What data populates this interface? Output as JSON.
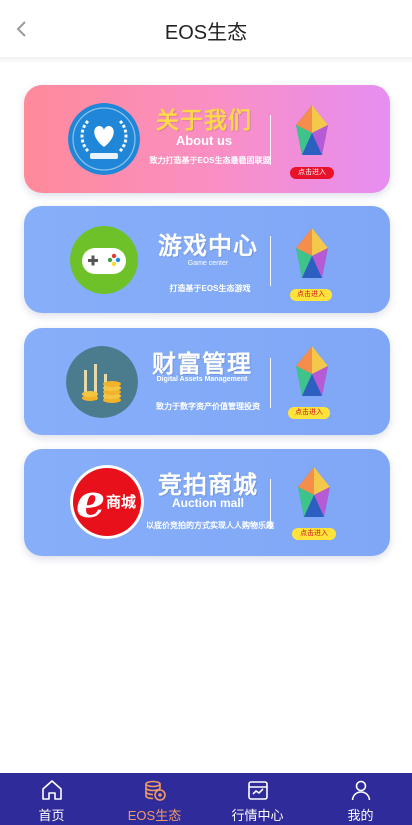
{
  "header": {
    "title": "EOS生态",
    "back_icon": "chevron-left-icon"
  },
  "cards": [
    {
      "key": "about",
      "title_cn": "关于我们",
      "title_en": "About us",
      "desc": "致力打造基于EOS生态最稳固联盟",
      "button": "点击进入",
      "icon": "heart-laurel-icon",
      "title_color": "#ffd84a",
      "button_bg": "#e8122b",
      "button_color": "#ffffff"
    },
    {
      "key": "game",
      "title_cn": "游戏中心",
      "title_en": "Game center",
      "desc": "打造基于EOS生态游戏",
      "button": "点击进入",
      "icon": "gamepad-icon",
      "button_bg": "#ffe33a",
      "button_color": "#d0191f"
    },
    {
      "key": "wealth",
      "title_cn": "财富管理",
      "title_en": "Digital Assets Management",
      "desc": "致力于数字资产价值管理投资",
      "button": "点击进入",
      "icon": "coins-chart-icon",
      "button_bg": "#ffe33a",
      "button_color": "#d0191f"
    },
    {
      "key": "auction",
      "title_cn": "竞拍商城",
      "title_en": "Auction mall",
      "desc": "以底价竞拍的方式实现人人购物乐趣",
      "button": "点击进入",
      "icon": "e-mall-logo-icon",
      "logo_text": "商城",
      "button_bg": "#ffe33a",
      "button_color": "#d0191f"
    }
  ],
  "tabbar": {
    "items": [
      {
        "label": "首页",
        "icon": "home-icon",
        "active": false
      },
      {
        "label": "EOS生态",
        "icon": "coin-stack-icon",
        "active": true
      },
      {
        "label": "行情中心",
        "icon": "chart-box-icon",
        "active": false
      },
      {
        "label": "我的",
        "icon": "user-icon",
        "active": false
      }
    ],
    "active_color": "#f29a63",
    "background": "#2f2b9a"
  }
}
